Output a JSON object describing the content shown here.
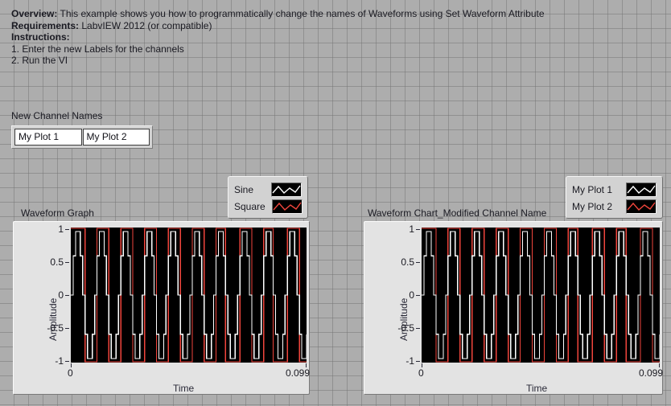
{
  "header": {
    "overview_lead": "Overview:",
    "overview_text": " This example shows you how to programmatically change the names of Waveforms using Set Waveform Attribute",
    "requirements_lead": "Requirements:",
    "requirements_text": " LabvIEW 2012 (or compatible)",
    "instructions_lead": "Instructions:",
    "step_1": "1. Enter the new Labels for the channels",
    "step_2": "2. Run the VI"
  },
  "channel_names": {
    "label": "New Channel Names",
    "values": [
      "My Plot 1",
      "My Plot 2"
    ],
    "placeholder": ""
  },
  "legend_left": {
    "rows": [
      {
        "name": "Sine",
        "color": "#ffffff",
        "swatch": "zigzag-plot-icon"
      },
      {
        "name": "Square",
        "color": "#f0453c",
        "swatch": "zigzag-plot-icon"
      }
    ]
  },
  "legend_right": {
    "rows": [
      {
        "name": "My Plot 1",
        "color": "#ffffff",
        "swatch": "zigzag-plot-icon"
      },
      {
        "name": "My Plot 2",
        "color": "#f0453c",
        "swatch": "zigzag-plot-icon"
      }
    ]
  },
  "graph_left": {
    "title": "Waveform Graph"
  },
  "graph_right": {
    "title": "Waveform Chart_Modified Channel Name"
  },
  "chart_data": {
    "type": "line",
    "title": "Waveform Graph",
    "xlabel": "Time",
    "ylabel": "Amplitude",
    "xlim": [
      0,
      0.099
    ],
    "ylim": [
      -1,
      1
    ],
    "xticks": [
      "0",
      "0.099"
    ],
    "yticks": [
      "1",
      "0.5",
      "0",
      "-0.5",
      "-1"
    ],
    "grid": false,
    "background": "#000000",
    "cycles": 10,
    "samples": 100,
    "legend_position": "above-right",
    "series": [
      {
        "name": "Sine",
        "alias": "My Plot 1",
        "color": "#ffffff",
        "waveform": "sine",
        "amplitude": 1,
        "frequency_cycles": 10
      },
      {
        "name": "Square",
        "alias": "My Plot 2",
        "color": "#f0453c",
        "waveform": "square",
        "amplitude": 1,
        "frequency_cycles": 10
      }
    ]
  }
}
